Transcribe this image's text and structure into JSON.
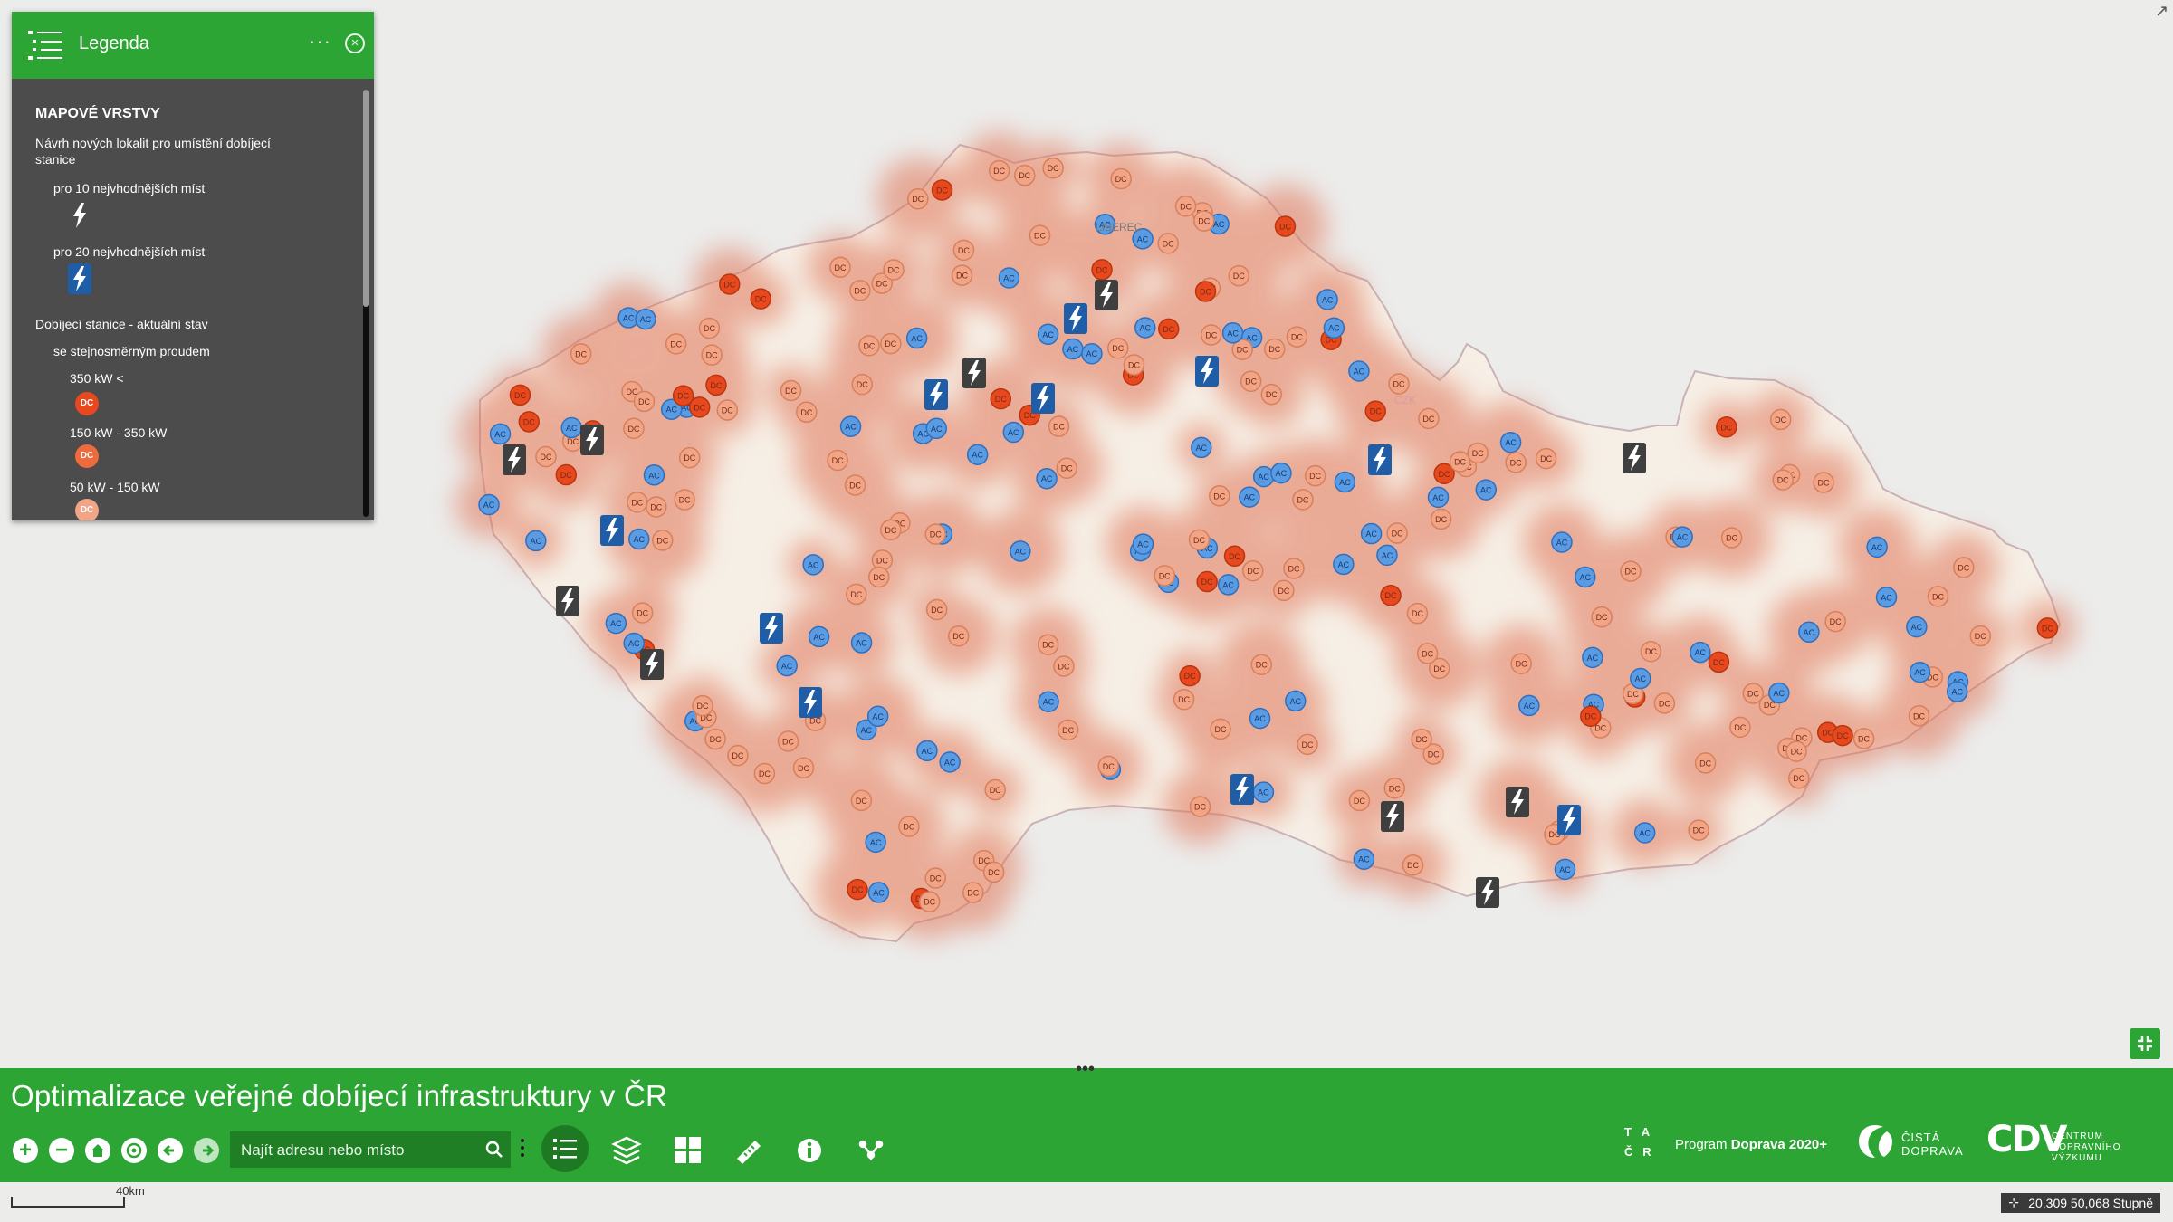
{
  "legend": {
    "title": "Legenda",
    "more_label": "···",
    "section_title": "MAPOVÉ VRSTVY",
    "layer1_title": "Návrh nových lokalit pro umístění dobíjecí stanice",
    "top10_label": "pro 10 nejvhodnějších míst",
    "top20_label": "pro 20 nejvhodnějších míst",
    "layer2_title": "Dobíjecí stanice - aktuální stav",
    "dc_subtitle": "se stejnosměrným proudem",
    "class1_label": "350 kW <",
    "class2_label": "150 kW - 350 kW",
    "class3_label": "50 kW - 150 kW",
    "dc_symbol_text": "DC",
    "colors": {
      "class1": "#e8481d",
      "class2": "#ef6a3c",
      "class3": "#f2a586",
      "top10": "#3f3f3f",
      "top20": "#1f5da6"
    }
  },
  "map": {
    "dc_text": "DC",
    "ac_text": "AC",
    "place_labels": [
      "LIBEREC",
      "CZK"
    ],
    "colors": {
      "country_fill": "#f6efe6",
      "heat": "#e07456",
      "ac": "#5b9be2",
      "dc": "#f2a586",
      "dc_strong": "#e8481d"
    }
  },
  "bottom": {
    "app_title": "Optimalizace veřejné dobíjecí infrastruktury v ČR",
    "search_placeholder": "Najít adresu nebo místo",
    "tacr_text": [
      "T",
      "A",
      "Č",
      "R"
    ],
    "program_label": "Program",
    "program_name": "Doprava 2020+",
    "brand2": [
      "ČISTÁ",
      "DOPRAVA"
    ],
    "brand3_letters": "CDV",
    "brand3": [
      "CENTRUM",
      "DOPRAVNÍHO",
      "VÝZKUMU"
    ]
  },
  "status": {
    "scale_label": "40km",
    "coordinates": "20,309 50,068 Stupně"
  }
}
